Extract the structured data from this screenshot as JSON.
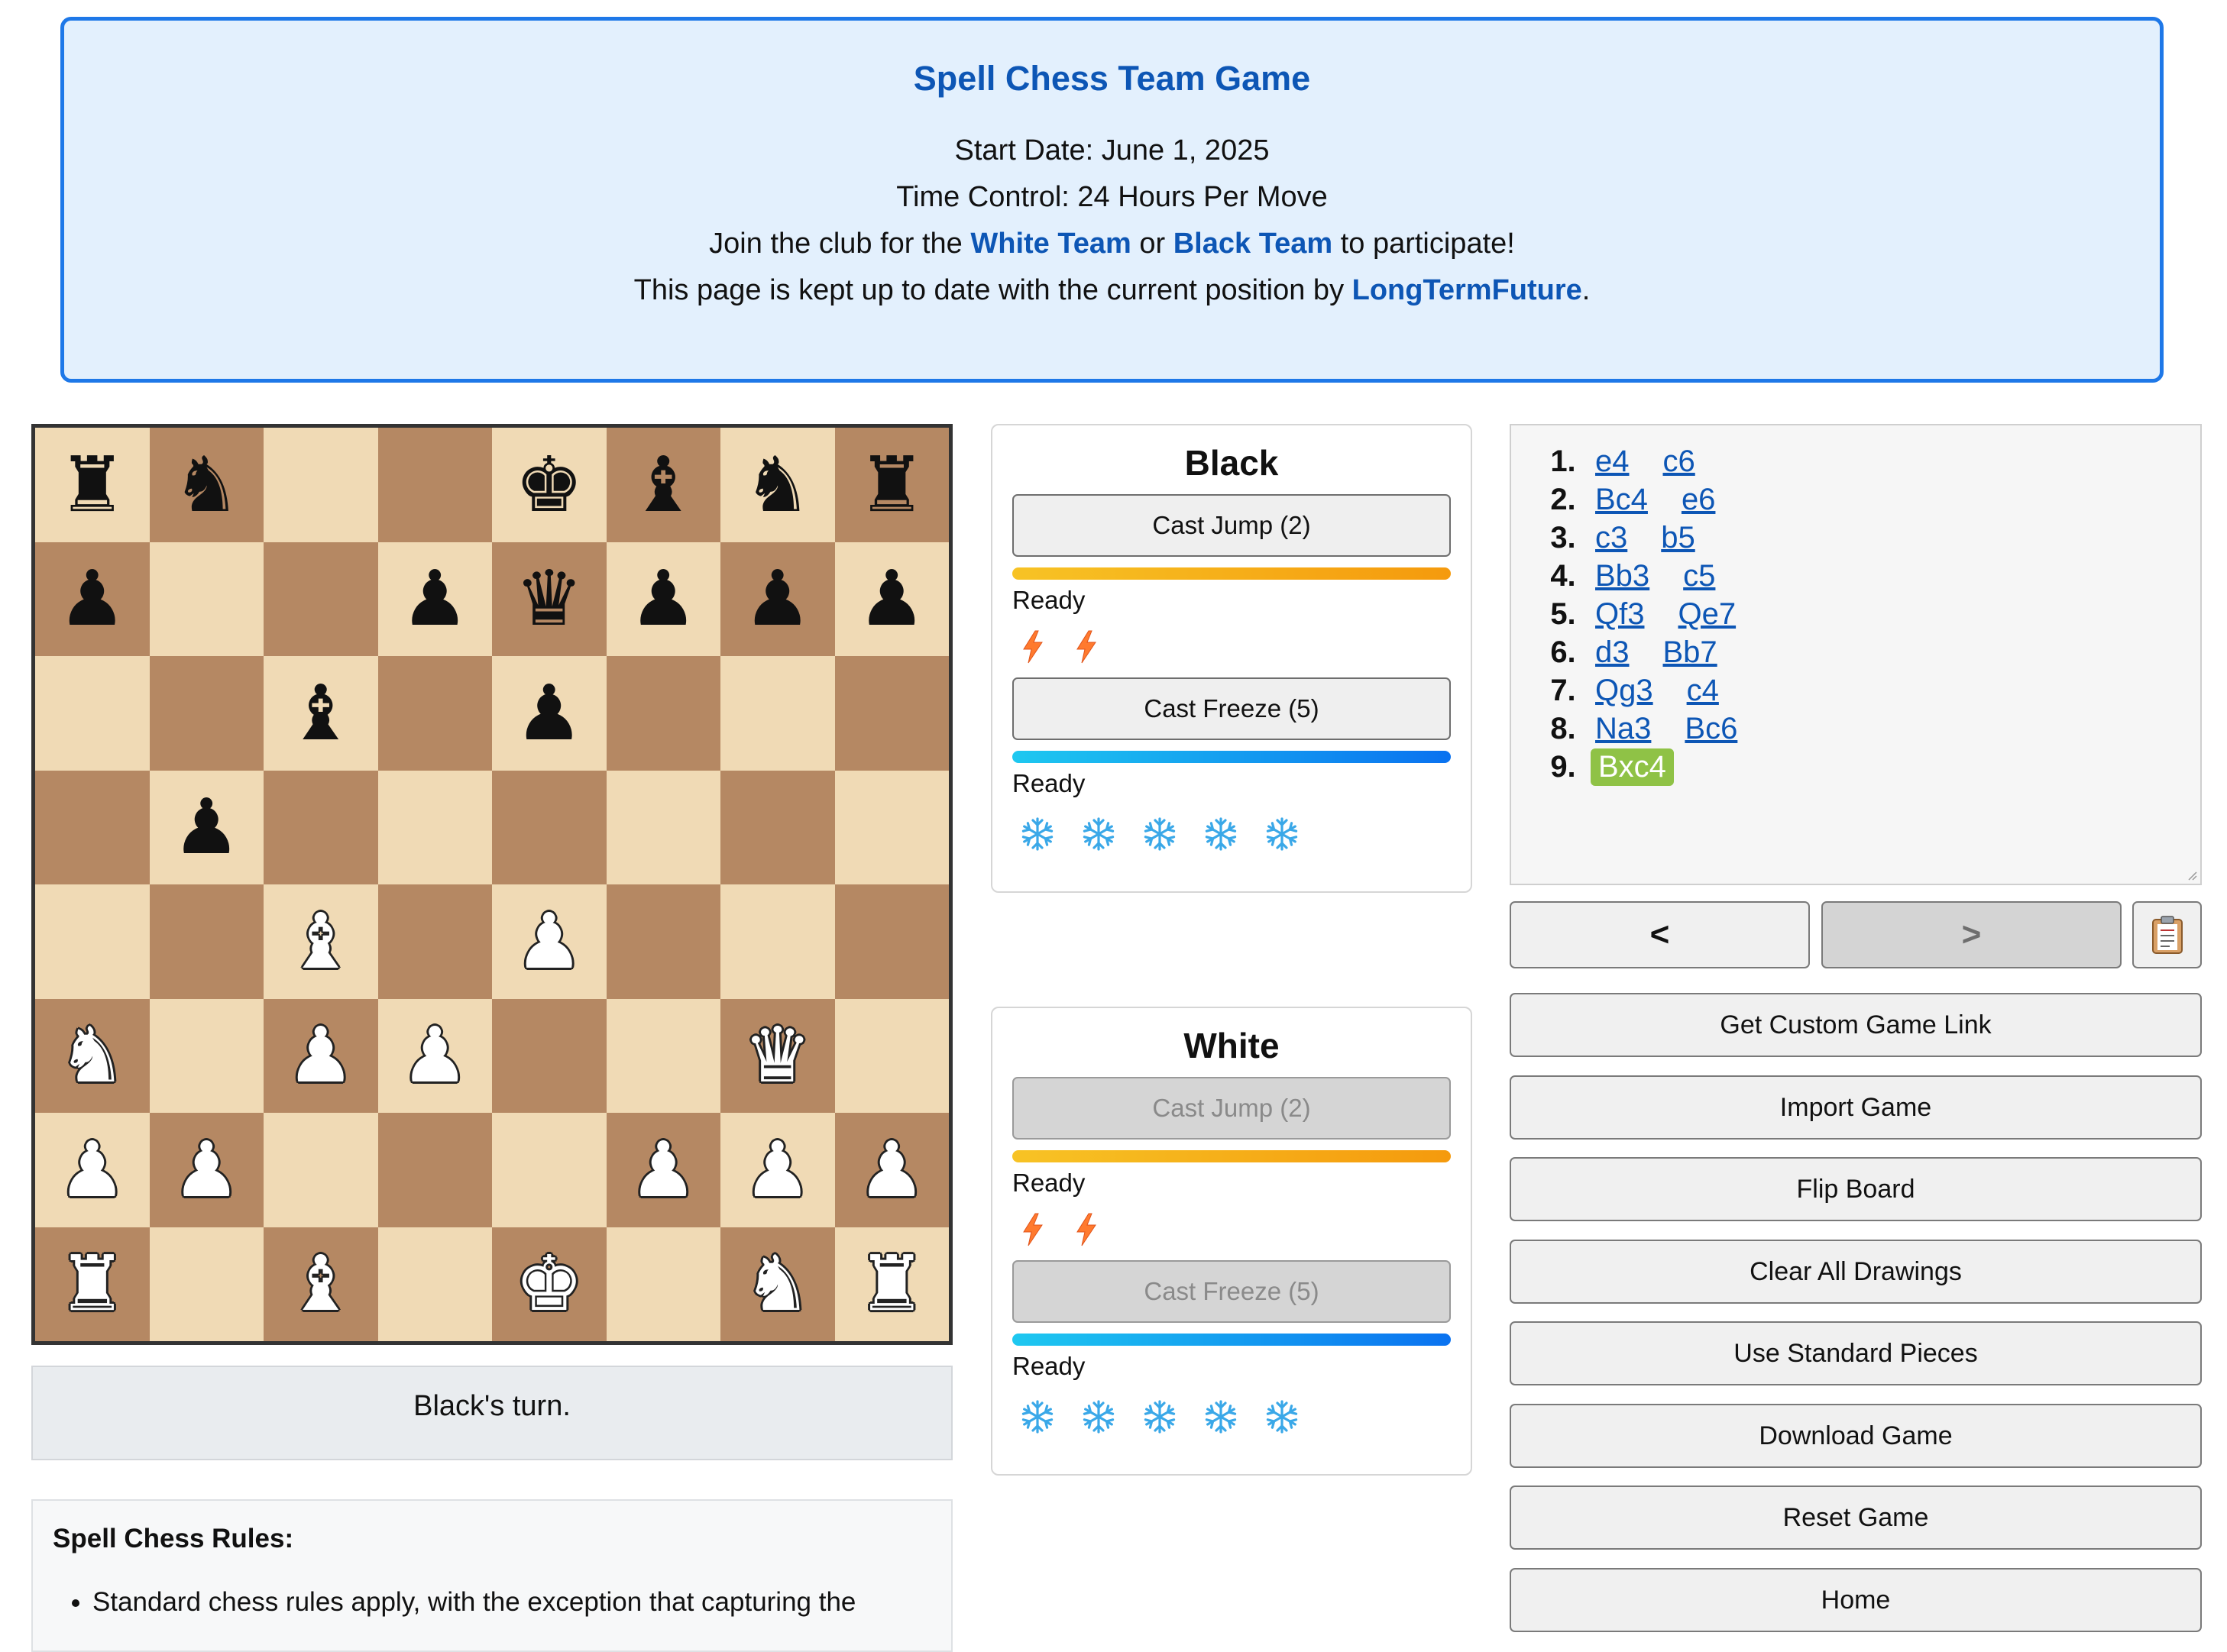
{
  "header": {
    "title": "Spell Chess Team Game",
    "start_date": "Start Date: June 1, 2025",
    "time_control": "Time Control: 24 Hours Per Move",
    "join_prefix": "Join the club for the ",
    "white_team": "White Team",
    "join_or": " or ",
    "black_team": "Black Team",
    "join_suffix": " to participate!",
    "kept_prefix": "This page is kept up to date with the current position by ",
    "kept_link": "LongTermFuture",
    "kept_suffix": "."
  },
  "board": {
    "rows": [
      [
        "bR",
        "bN",
        "",
        "",
        "bK",
        "bB",
        "bN",
        "bR"
      ],
      [
        "bP",
        "",
        "",
        "bP",
        "bQ",
        "bP",
        "bP",
        "bP"
      ],
      [
        "",
        "",
        "bB",
        "",
        "bP",
        "",
        "",
        ""
      ],
      [
        "",
        "bP",
        "",
        "",
        "",
        "",
        "",
        ""
      ],
      [
        "",
        "",
        "wB",
        "",
        "wP",
        "",
        "",
        ""
      ],
      [
        "wN",
        "",
        "wP",
        "wP",
        "",
        "",
        "wQ",
        ""
      ],
      [
        "wP",
        "wP",
        "",
        "",
        "",
        "wP",
        "wP",
        "wP"
      ],
      [
        "wR",
        "",
        "wB",
        "",
        "wK",
        "",
        "wN",
        "wR"
      ]
    ]
  },
  "turn_text": "Black's turn.",
  "rules": {
    "title": "Spell Chess Rules:",
    "items": [
      "Standard chess rules apply, with the exception that capturing the"
    ]
  },
  "panels": {
    "black": {
      "title": "Black",
      "jump_label": "Cast Jump (2)",
      "jump_status": "Ready",
      "jump_charges": 2,
      "freeze_label": "Cast Freeze (5)",
      "freeze_status": "Ready",
      "freeze_charges": 5
    },
    "white": {
      "title": "White",
      "jump_label": "Cast Jump (2)",
      "jump_status": "Ready",
      "jump_charges": 2,
      "freeze_label": "Cast Freeze (5)",
      "freeze_status": "Ready",
      "freeze_charges": 5
    }
  },
  "moves": [
    {
      "num": "1.",
      "white": "e4",
      "black": "c6"
    },
    {
      "num": "2.",
      "white": "Bc4",
      "black": "e6"
    },
    {
      "num": "3.",
      "white": "c3",
      "black": "b5"
    },
    {
      "num": "4.",
      "white": "Bb3",
      "black": "c5"
    },
    {
      "num": "5.",
      "white": "Qf3",
      "black": "Qe7"
    },
    {
      "num": "6.",
      "white": "d3",
      "black": "Bb7"
    },
    {
      "num": "7.",
      "white": "Qg3",
      "black": "c4"
    },
    {
      "num": "8.",
      "white": "Na3",
      "black": "Bc6"
    },
    {
      "num": "9.",
      "white": "Bxc4",
      "black": ""
    }
  ],
  "highlighted_move": "Bxc4",
  "nav": {
    "prev": "<",
    "next": ">"
  },
  "actions": {
    "custom_link": "Get Custom Game Link",
    "import": "Import Game",
    "flip": "Flip Board",
    "clear": "Clear All Drawings",
    "standard_pieces": "Use Standard Pieces",
    "download": "Download Game",
    "reset": "Reset Game",
    "home": "Home"
  },
  "colors": {
    "light_square": "#f0dab5",
    "dark_square": "#b58863",
    "link": "#0d56b5",
    "header_border": "#1e78e8",
    "highlight": "#8fc246"
  }
}
